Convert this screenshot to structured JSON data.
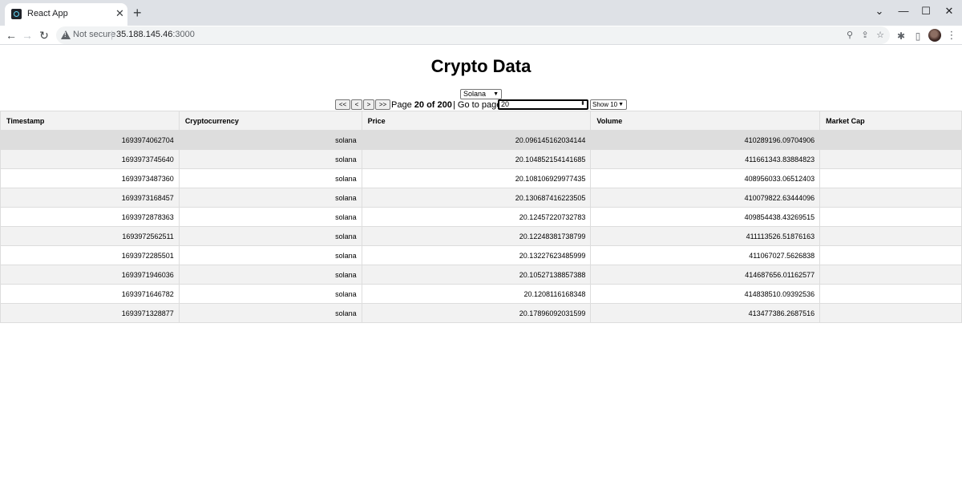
{
  "browser": {
    "tab_title": "React App",
    "tab_close": "✕",
    "new_tab": "+",
    "security_label": "Not secure",
    "url_host": "35.188.145.46",
    "url_port": ":3000",
    "window_controls": {
      "minimize": "—",
      "restore": "☐",
      "close": "✕",
      "tab_search": "⌄"
    },
    "icons": [
      "zoom-icon",
      "share-icon",
      "bookmark-star-icon",
      "extensions-icon",
      "sidepanel-icon",
      "profile-avatar",
      "menu-icon"
    ]
  },
  "page": {
    "title": "Crypto Data",
    "crypto_select": {
      "value": "Solana"
    },
    "pagination": {
      "first": "<<",
      "prev": "<",
      "next": ">",
      "last": ">>",
      "page_word": "Page",
      "current_page": "20",
      "of_word": "of",
      "total_pages": "200",
      "separator": "|",
      "goto_label": "Go to page:",
      "goto_value": "20",
      "show_value": "Show 10"
    },
    "table": {
      "headers": [
        "Timestamp",
        "Cryptocurrency",
        "Price",
        "Volume",
        "Market Cap"
      ],
      "rows": [
        [
          "1693974062704",
          "solana",
          "20.096145162034144",
          "410289196.09704906",
          ""
        ],
        [
          "1693973745640",
          "solana",
          "20.104852154141685",
          "411661343.83884823",
          ""
        ],
        [
          "1693973487360",
          "solana",
          "20.108106929977435",
          "408956033.06512403",
          ""
        ],
        [
          "1693973168457",
          "solana",
          "20.130687416223505",
          "410079822.63444096",
          ""
        ],
        [
          "1693972878363",
          "solana",
          "20.12457220732783",
          "409854438.43269515",
          ""
        ],
        [
          "1693972562511",
          "solana",
          "20.12248381738799",
          "411113526.51876163",
          ""
        ],
        [
          "1693972285501",
          "solana",
          "20.13227623485999",
          "411067027.5626838",
          ""
        ],
        [
          "1693971946036",
          "solana",
          "20.10527138857388",
          "414687656.01162577",
          ""
        ],
        [
          "1693971646782",
          "solana",
          "20.1208116168348",
          "414838510.09392536",
          ""
        ],
        [
          "1693971328877",
          "solana",
          "20.17896092031599",
          "413477386.2687516",
          ""
        ]
      ]
    }
  }
}
